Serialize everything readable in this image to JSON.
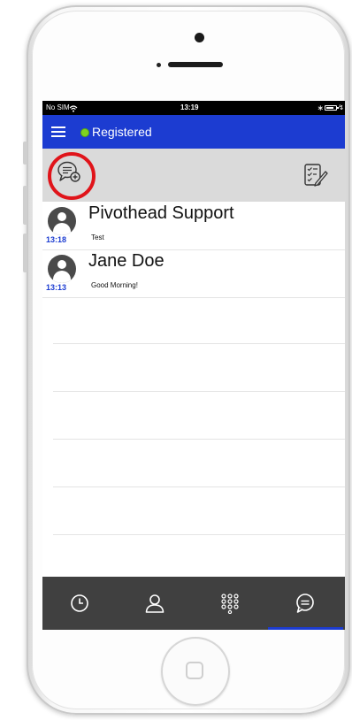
{
  "status_bar": {
    "carrier": "No SIM",
    "wifi_icon": "wifi-icon",
    "time": "13:19",
    "bluetooth_icon": "bluetooth-icon",
    "battery_icon": "battery-icon"
  },
  "header": {
    "menu_icon": "hamburger-menu-icon",
    "registration_status": "Registered",
    "status_color": "#7ed321",
    "bar_color": "#1c3cd1"
  },
  "toolbar": {
    "new_chat_icon": "new-chat-icon",
    "highlight_color": "#e0141a",
    "edit_icon": "edit-checklist-icon"
  },
  "conversations": [
    {
      "name": "Pivothead Support",
      "preview": "Test",
      "time": "13:18"
    },
    {
      "name": "Jane Doe",
      "preview": "Good Morning!",
      "time": "13:13"
    }
  ],
  "tabs": [
    {
      "icon": "history-clock-icon",
      "active": false
    },
    {
      "icon": "contacts-person-icon",
      "active": false
    },
    {
      "icon": "dialpad-icon",
      "active": false
    },
    {
      "icon": "chat-bubble-icon",
      "active": true
    }
  ]
}
